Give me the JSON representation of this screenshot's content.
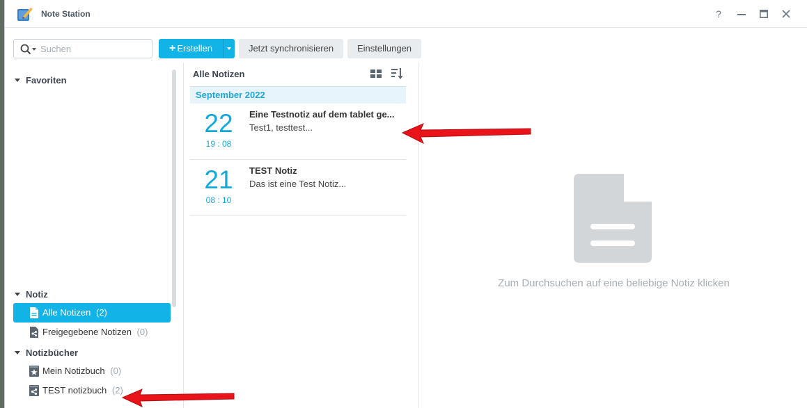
{
  "window": {
    "title": "Note Station",
    "help_glyph": "?",
    "minimize_glyph": "—",
    "maximize_glyph": "▣",
    "close_glyph": "✕"
  },
  "toolbar": {
    "search_placeholder": "Suchen",
    "create_label": "Erstellen",
    "create_plus": "+",
    "sync_label": "Jetzt synchronisieren",
    "settings_label": "Einstellungen"
  },
  "sidebar": {
    "favorites_header": "Favoriten",
    "notes_header": "Notiz",
    "notes_items": [
      {
        "label": "Alle Notizen",
        "count": "(2)",
        "icon": "document-icon",
        "active": true
      },
      {
        "label": "Freigegebene Notizen",
        "count": "(0)",
        "icon": "shared-notes-icon",
        "active": false
      }
    ],
    "notebooks_header": "Notizbücher",
    "notebook_items": [
      {
        "label": "Mein Notizbuch",
        "count": "(0)",
        "icon": "notebook-star-icon"
      },
      {
        "label": "TEST notizbuch",
        "count": "(2)",
        "icon": "notebook-shared-icon"
      }
    ]
  },
  "notelist": {
    "title": "Alle Notizen",
    "month_header": "September 2022",
    "notes": [
      {
        "day": "22",
        "time": "19 : 08",
        "title": "Eine Testnotiz auf dem tablet ge...",
        "preview": "Test1, testtest..."
      },
      {
        "day": "21",
        "time": "08 : 10",
        "title": "TEST Notiz",
        "preview": "Das ist eine Test Notiz..."
      }
    ]
  },
  "viewer": {
    "empty_message": "Zum Durchsuchen auf eine beliebige Notiz klicken"
  },
  "colors": {
    "accent": "#12b3e6",
    "annotation_arrow": "#e8141a"
  }
}
